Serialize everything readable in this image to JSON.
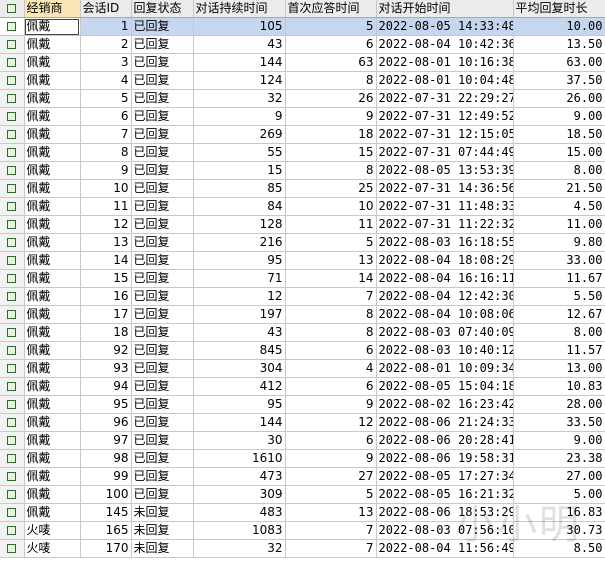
{
  "columns": [
    "经销商",
    "会话ID",
    "回复状态",
    "对话持续时间",
    "首次应答时间",
    "对话开始时间",
    "平均回复时长"
  ],
  "rows": [
    [
      "佩戴",
      "1",
      "已回复",
      "105",
      "5",
      "2022-08-05 14:33:48",
      "10.00"
    ],
    [
      "佩戴",
      "2",
      "已回复",
      "43",
      "6",
      "2022-08-04 10:42:36",
      "13.50"
    ],
    [
      "佩戴",
      "3",
      "已回复",
      "144",
      "63",
      "2022-08-01 10:16:38",
      "63.00"
    ],
    [
      "佩戴",
      "4",
      "已回复",
      "124",
      "8",
      "2022-08-01 10:04:48",
      "37.50"
    ],
    [
      "佩戴",
      "5",
      "已回复",
      "32",
      "26",
      "2022-07-31 22:29:27",
      "26.00"
    ],
    [
      "佩戴",
      "6",
      "已回复",
      "9",
      "9",
      "2022-07-31 12:49:52",
      "9.00"
    ],
    [
      "佩戴",
      "7",
      "已回复",
      "269",
      "18",
      "2022-07-31 12:15:05",
      "18.50"
    ],
    [
      "佩戴",
      "8",
      "已回复",
      "55",
      "15",
      "2022-07-31 07:44:49",
      "15.00"
    ],
    [
      "佩戴",
      "9",
      "已回复",
      "15",
      "8",
      "2022-08-05 13:53:39",
      "8.00"
    ],
    [
      "佩戴",
      "10",
      "已回复",
      "85",
      "25",
      "2022-07-31 14:36:56",
      "21.50"
    ],
    [
      "佩戴",
      "11",
      "已回复",
      "84",
      "10",
      "2022-07-31 11:48:33",
      "4.50"
    ],
    [
      "佩戴",
      "12",
      "已回复",
      "128",
      "11",
      "2022-07-31 11:22:32",
      "11.00"
    ],
    [
      "佩戴",
      "13",
      "已回复",
      "216",
      "5",
      "2022-08-03 16:18:55",
      "9.80"
    ],
    [
      "佩戴",
      "14",
      "已回复",
      "95",
      "13",
      "2022-08-04 18:08:29",
      "33.00"
    ],
    [
      "佩戴",
      "15",
      "已回复",
      "71",
      "14",
      "2022-08-04 16:16:11",
      "11.67"
    ],
    [
      "佩戴",
      "16",
      "已回复",
      "12",
      "7",
      "2022-08-04 12:42:30",
      "5.50"
    ],
    [
      "佩戴",
      "17",
      "已回复",
      "197",
      "8",
      "2022-08-04 10:08:06",
      "12.67"
    ],
    [
      "佩戴",
      "18",
      "已回复",
      "43",
      "8",
      "2022-08-03 07:40:09",
      "8.00"
    ],
    [
      "佩戴",
      "92",
      "已回复",
      "845",
      "6",
      "2022-08-03 10:40:12",
      "11.57"
    ],
    [
      "佩戴",
      "93",
      "已回复",
      "304",
      "4",
      "2022-08-01 10:09:34",
      "13.00"
    ],
    [
      "佩戴",
      "94",
      "已回复",
      "412",
      "6",
      "2022-08-05 15:04:18",
      "10.83"
    ],
    [
      "佩戴",
      "95",
      "已回复",
      "95",
      "9",
      "2022-08-02 16:23:42",
      "28.00"
    ],
    [
      "佩戴",
      "96",
      "已回复",
      "144",
      "12",
      "2022-08-06 21:24:33",
      "33.50"
    ],
    [
      "佩戴",
      "97",
      "已回复",
      "30",
      "6",
      "2022-08-06 20:28:41",
      "9.00"
    ],
    [
      "佩戴",
      "98",
      "已回复",
      "1610",
      "9",
      "2022-08-06 19:58:31",
      "23.38"
    ],
    [
      "佩戴",
      "99",
      "已回复",
      "473",
      "27",
      "2022-08-05 17:27:34",
      "27.00"
    ],
    [
      "佩戴",
      "100",
      "已回复",
      "309",
      "5",
      "2022-08-05 16:21:32",
      "5.00"
    ],
    [
      "佩戴",
      "145",
      "未回复",
      "483",
      "13",
      "2022-08-06 18:53:29",
      "16.83"
    ],
    [
      "火唛",
      "165",
      "未回复",
      "1083",
      "7",
      "2022-08-03 07:56:10",
      "30.73"
    ],
    [
      "火唛",
      "170",
      "未回复",
      "32",
      "7",
      "2022-08-04 11:56:49",
      "8.50"
    ]
  ],
  "watermark": "小小明",
  "colors": {
    "header": "#ececec",
    "header_highlight": "#fbe7b5",
    "selected_cell": "#c5d6ee",
    "grid_line": "#c8c8c8"
  }
}
